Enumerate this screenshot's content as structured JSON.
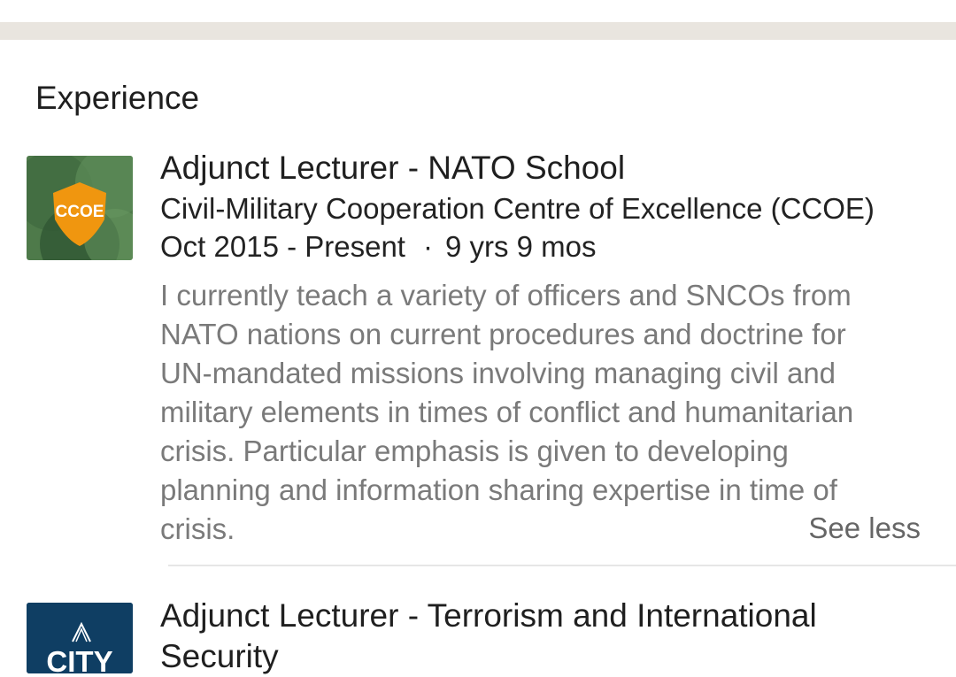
{
  "section": {
    "title": "Experience"
  },
  "entries": [
    {
      "logo": {
        "text": "CCOE",
        "colors": {
          "bg": "#4e7a4a",
          "shield": "#f0960f"
        }
      },
      "title": "Adjunct Lecturer - NATO School",
      "company": "Civil-Military Cooperation Centre of Excellence (CCOE)",
      "date_range": "Oct 2015 - Present",
      "separator": "·",
      "duration": "9 yrs 9 mos",
      "description_lines": [
        "I currently teach a variety of officers and SNCOs from",
        "NATO nations on current procedures and doctrine for",
        "UN-mandated missions involving managing civil and",
        "military elements in times of conflict and humanitarian",
        "crisis. Particular emphasis is given to developing",
        "planning and information sharing expertise in time of",
        "crisis."
      ],
      "toggle_label": "See less"
    },
    {
      "logo": {
        "text": "CITY",
        "colors": {
          "bg": "#0f3e63"
        }
      },
      "title_lines": [
        "Adjunct Lecturer - Terrorism and International",
        "Security"
      ]
    }
  ],
  "colors": {
    "divider_band": "#e9e5df",
    "title_text": "#1f1f1f",
    "description_text": "#7a7a7a"
  }
}
